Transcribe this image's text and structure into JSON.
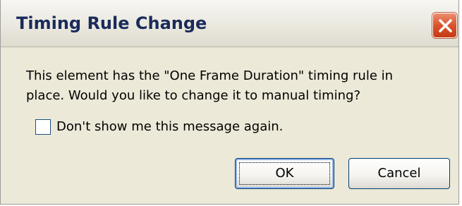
{
  "dialog": {
    "title": "Timing Rule Change",
    "close_icon": "close-x-icon",
    "message": "This element has the \"One Frame Duration\" timing rule in place. Would you like to change it to manual timing?",
    "checkbox": {
      "label": "Don't show me this message again.",
      "checked": false
    },
    "buttons": {
      "ok_label": "OK",
      "cancel_label": "Cancel"
    }
  },
  "colors": {
    "title_text": "#1a2b5b",
    "dialog_background": "#ece9d8",
    "close_button": "#d9532c",
    "button_border": "#003c74"
  }
}
